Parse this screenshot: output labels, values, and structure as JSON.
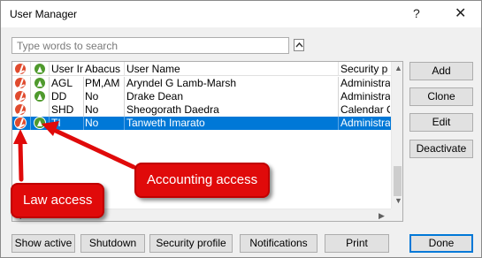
{
  "window": {
    "title": "User Manager",
    "help_glyph": "?",
    "close_glyph": "✕"
  },
  "search": {
    "placeholder": "Type words to search"
  },
  "grid": {
    "columns": [
      "User In",
      "Abacus",
      "User Name",
      "Security p"
    ],
    "rows": [
      {
        "law": true,
        "acc": true,
        "user_in": "AGL",
        "abacus": "PM,AM",
        "name": "Aryndel G Lamb-Marsh",
        "security": "Administra",
        "selected": false
      },
      {
        "law": true,
        "acc": true,
        "user_in": "DD",
        "abacus": "No",
        "name": "Drake Dean",
        "security": "Administra",
        "selected": false
      },
      {
        "law": true,
        "acc": false,
        "user_in": "SHD",
        "abacus": "No",
        "name": "Sheogorath Daedra",
        "security": "Calendar C",
        "selected": false
      },
      {
        "law": true,
        "acc": true,
        "user_in": "TI",
        "abacus": "No",
        "name": "Tanweth Imarato",
        "security": "Administra",
        "selected": true
      }
    ]
  },
  "side_buttons": {
    "add": "Add",
    "clone": "Clone",
    "edit": "Edit",
    "deactivate": "Deactivate"
  },
  "bottom_buttons": {
    "show_active": "Show active",
    "shutdown": "Shutdown",
    "security_profile": "Security profile",
    "notifications": "Notifications",
    "print": "Print",
    "done": "Done"
  },
  "callouts": {
    "accounting": "Accounting access",
    "law": "Law access"
  },
  "colors": {
    "law_icon": "#e04b2e",
    "accounting_icon": "#4f9a2d",
    "selection": "#0078d7",
    "callout": "#e00a0a"
  },
  "icons": {
    "law": "law-access-icon",
    "accounting": "accounting-access-icon"
  }
}
